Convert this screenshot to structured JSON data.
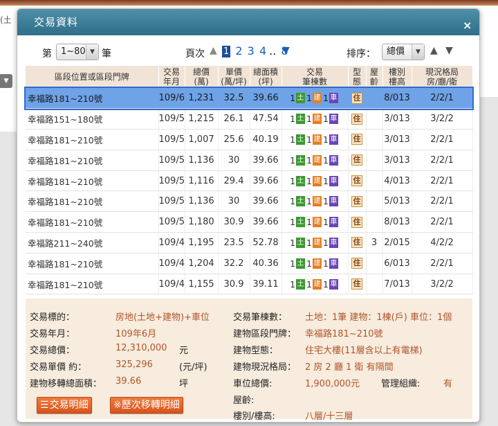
{
  "background": {
    "left_text": "(土",
    "left_button_icon": "chevron-down-icon"
  },
  "dialog": {
    "title": "交易資料",
    "close_icon": "close-icon"
  },
  "toolbar": {
    "di": "第",
    "range_value": "1~80",
    "bi": "筆",
    "page_label": "頁次",
    "pages": [
      "1",
      "2",
      "3",
      "4"
    ],
    "current_page": "1",
    "dots": "..",
    "last_page": "8",
    "sort_label": "排序：",
    "sort_value": "總價"
  },
  "table": {
    "headers": [
      "區段位置或區段門牌",
      "交易\n年月",
      "總價\n(萬)",
      "單價\n(萬/坪)",
      "總面積\n(坪)",
      "交易\n筆棟數",
      "型\n態",
      "屋\n齡",
      "樓別\n樓高",
      "現況格局\n房/廳/衛"
    ],
    "rows": [
      {
        "addr": "幸福路181~210號",
        "ym": "109/6",
        "total": "1,231",
        "unit": "32.5",
        "area": "39.66",
        "land": "1",
        "bld": "1",
        "car": "1",
        "type": "住",
        "age": "",
        "floor": "8/013",
        "layout": "2/2/1",
        "selected": true
      },
      {
        "addr": "幸福路151~180號",
        "ym": "109/5",
        "total": "1,215",
        "unit": "26.1",
        "area": "47.54",
        "land": "1",
        "bld": "1",
        "car": "1",
        "type": "住",
        "age": "",
        "floor": "3/013",
        "layout": "3/2/2"
      },
      {
        "addr": "幸福路181~210號",
        "ym": "109/5",
        "total": "1,007",
        "unit": "25.6",
        "area": "40.19",
        "land": "1",
        "bld": "1",
        "car": "1",
        "type": "住",
        "age": "",
        "floor": "3/013",
        "layout": "2/2/1"
      },
      {
        "addr": "幸福路181~210號",
        "ym": "109/5",
        "total": "1,136",
        "unit": "30",
        "area": "39.66",
        "land": "1",
        "bld": "1",
        "car": "1",
        "type": "住",
        "age": "",
        "floor": "3/013",
        "layout": "2/2/1"
      },
      {
        "addr": "幸福路181~210號",
        "ym": "109/5",
        "total": "1,116",
        "unit": "29.4",
        "area": "39.66",
        "land": "1",
        "bld": "1",
        "car": "1",
        "type": "住",
        "age": "",
        "floor": "4/013",
        "layout": "2/2/1"
      },
      {
        "addr": "幸福路181~210號",
        "ym": "109/5",
        "total": "1,136",
        "unit": "30",
        "area": "39.66",
        "land": "1",
        "bld": "1",
        "car": "1",
        "type": "住",
        "age": "",
        "floor": "5/013",
        "layout": "2/2/1"
      },
      {
        "addr": "幸福路181~210號",
        "ym": "109/5",
        "total": "1,180",
        "unit": "30.9",
        "area": "39.66",
        "land": "1",
        "bld": "1",
        "car": "1",
        "type": "住",
        "age": "",
        "floor": "8/013",
        "layout": "2/2/1"
      },
      {
        "addr": "幸福路211~240號",
        "ym": "109/4",
        "total": "1,195",
        "unit": "23.5",
        "area": "52.78",
        "land": "1",
        "bld": "1",
        "car": "1",
        "type": "住",
        "age": "3",
        "floor": "2/015",
        "layout": "4/2/2"
      },
      {
        "addr": "幸福路181~210號",
        "ym": "109/4",
        "total": "1,204",
        "unit": "32.2",
        "area": "40.36",
        "land": "1",
        "bld": "1",
        "car": "1",
        "type": "住",
        "age": "",
        "floor": "6/013",
        "layout": "2/2/1"
      },
      {
        "addr": "幸福路181~210號",
        "ym": "109/4",
        "total": "1,155",
        "unit": "30.9",
        "area": "39.11",
        "land": "1",
        "bld": "1",
        "car": "1",
        "type": "住",
        "age": "",
        "floor": "7/013",
        "layout": "3/2/2"
      }
    ],
    "badge_land": "土",
    "badge_bld": "建",
    "badge_car": "車"
  },
  "detail": {
    "target_label": "交易標的：",
    "target_value": "房地(土地+建物)+車位",
    "ym_label": "交易年月：",
    "ym_value": "109年6月",
    "total_label": "交易總價：",
    "total_value": "12,310,000",
    "total_unit": "元",
    "unit_label": "交易單價 約：",
    "unit_value": "325,296",
    "unit_unit": "(元/坪)",
    "area_label": "建物移轉總面積：",
    "area_value": "39.66",
    "area_unit": "坪",
    "count_label": "交易筆棟數：",
    "count_value": "土地：1筆 建物：1棟(戶) 車位：1個",
    "addr_label": "建物區段門牌：",
    "addr_value": "幸福路181~210號",
    "type_label": "建物型態：",
    "type_value": "住宅大樓(11層含以上有電梯)",
    "layout_label": "建物現況格局：",
    "layout_value": "2 房 2 廳 1 衛 有隔間",
    "parking_label": "車位總價:",
    "parking_value": "1,900,000元",
    "mgmt_label": "管理組織:",
    "mgmt_value": "有",
    "age_label": "屋齡:",
    "age_value": "",
    "floor_label": "樓別/樓高:",
    "floor_value": "八層/十三層",
    "btn_detail": "交易明細",
    "btn_history": "※歷次移轉明細"
  },
  "colors": {
    "header_bg": "#2f6e88",
    "selected_row": "#6fa3e8",
    "table_header_bg": "#f1e4d7",
    "detail_bg": "#f7ecdd",
    "value_text": "#b0542b",
    "button_bg": "#e06426"
  }
}
